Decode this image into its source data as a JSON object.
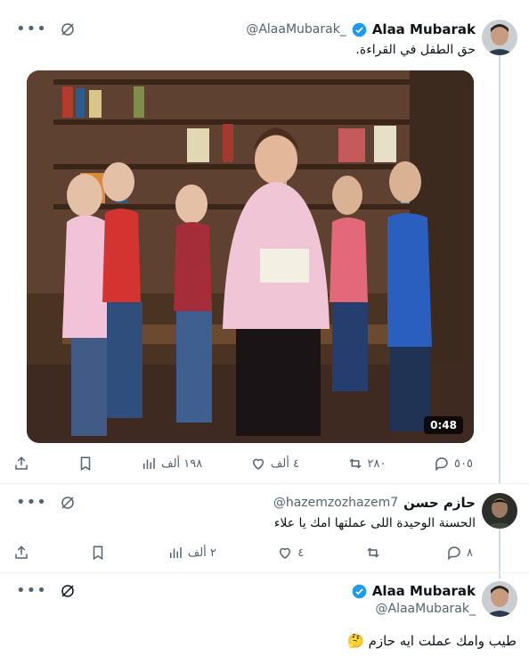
{
  "tweets": [
    {
      "name": "Alaa Mubarak",
      "handle": "@AlaaMubarak_",
      "text": "حق الطفل في القراءة.",
      "video_duration": "0:48",
      "stats": {
        "replies": "٥٠٥",
        "reposts": "٢٨٠",
        "likes": "٤ ألف",
        "views": "١٩٨ ألف"
      }
    },
    {
      "name": "حازم حسن",
      "handle": "@hazemzozhazem7",
      "text": "الحسنة الوحيدة اللى عملتها امك يا علاء",
      "stats": {
        "replies": "٨",
        "reposts": "",
        "likes": "٤",
        "views": "٢ ألف"
      }
    },
    {
      "name": "Alaa Mubarak",
      "handle": "@AlaaMubarak_",
      "text": "طيب وامك عملت ايه حازم 🤔"
    }
  ],
  "colors": {
    "accent": "#1d9bf0",
    "muted": "#536471",
    "thread_line": "#cfd9de"
  }
}
